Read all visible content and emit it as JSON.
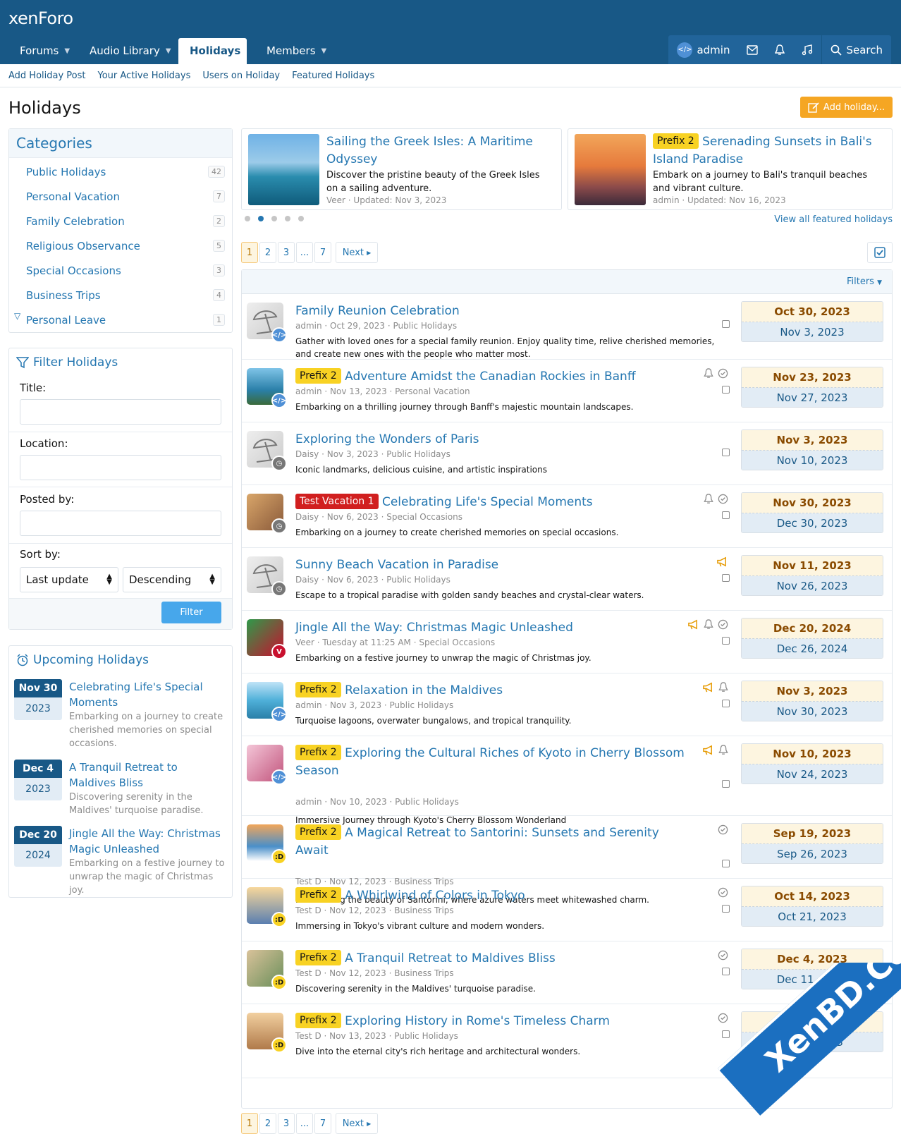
{
  "header": {
    "logo": "xenForo",
    "tabs": [
      {
        "label": "Forums"
      },
      {
        "label": "Audio Library"
      },
      {
        "label": "Holidays"
      },
      {
        "label": "Members"
      }
    ],
    "user": "admin",
    "search": "Search"
  },
  "subnav": [
    "Add Holiday Post",
    "Your Active Holidays",
    "Users on Holiday",
    "Featured Holidays"
  ],
  "page": {
    "title": "Holidays",
    "add_button": "Add holiday..."
  },
  "categories": {
    "title": "Categories",
    "items": [
      {
        "label": "Public Holidays",
        "count": "42"
      },
      {
        "label": "Personal Vacation",
        "count": "7"
      },
      {
        "label": "Family Celebration",
        "count": "2"
      },
      {
        "label": "Religious Observance",
        "count": "5"
      },
      {
        "label": "Special Occasions",
        "count": "3"
      },
      {
        "label": "Business Trips",
        "count": "4"
      },
      {
        "label": "Personal Leave",
        "count": "1"
      }
    ]
  },
  "filter": {
    "title": "Filter Holidays",
    "title_label": "Title:",
    "location_label": "Location:",
    "posted_label": "Posted by:",
    "sort_label": "Sort by:",
    "sort_value": "Last update",
    "order_value": "Descending",
    "button": "Filter"
  },
  "upcoming": {
    "title": "Upcoming Holidays",
    "items": [
      {
        "day": "Nov 30",
        "year": "2023",
        "title": "Celebrating Life's Special Moments",
        "desc": "Embarking on a journey to create cherished memories on special occasions."
      },
      {
        "day": "Dec 4",
        "year": "2023",
        "title": "A Tranquil Retreat to Maldives Bliss",
        "desc": "Discovering serenity in the Maldives' turquoise paradise."
      },
      {
        "day": "Dec 20",
        "year": "2024",
        "title": "Jingle All the Way: Christmas Magic Unleashed",
        "desc": "Embarking on a festive journey to unwrap the magic of Christmas joy."
      }
    ]
  },
  "featured": [
    {
      "prefix": "",
      "title": "Sailing the Greek Isles: A Maritime Odyssey",
      "desc": "Discover the pristine beauty of the Greek Isles on a sailing adventure.",
      "meta": "Veer · Updated: Nov 3, 2023"
    },
    {
      "prefix": "Prefix 2",
      "title": "Serenading Sunsets in Bali's Island Paradise",
      "desc": "Embark on a journey to Bali's tranquil beaches and vibrant culture.",
      "meta": "admin · Updated: Nov 16, 2023"
    }
  ],
  "view_all": "View all featured holidays",
  "pager": {
    "pages": [
      "1",
      "2",
      "3",
      "...",
      "7"
    ],
    "next": "Next"
  },
  "filters_link": "Filters",
  "rows": [
    {
      "prefix": "",
      "ptype": "",
      "title": "Family Reunion Celebration",
      "meta": "admin · Oct 29, 2023 · Public Holidays",
      "desc": "Gather with loved ones for a special family reunion. Enjoy quality time, relive cherished memories, and create new ones with the people who matter most.",
      "start": "Oct 30, 2023",
      "end": "Nov 3, 2023"
    },
    {
      "prefix": "Prefix 2",
      "ptype": "y",
      "title": "Adventure Amidst the Canadian Rockies in Banff",
      "meta": "admin · Nov 13, 2023 · Personal Vacation",
      "desc": "Embarking on a thrilling journey through Banff's majestic mountain landscapes.",
      "start": "Nov 23, 2023",
      "end": "Nov 27, 2023"
    },
    {
      "prefix": "",
      "ptype": "",
      "title": "Exploring the Wonders of Paris",
      "meta": "Daisy · Nov 3, 2023 · Public Holidays",
      "desc": "Iconic landmarks, delicious cuisine, and artistic inspirations",
      "start": "Nov 3, 2023",
      "end": "Nov 10, 2023"
    },
    {
      "prefix": "Test Vacation 1",
      "ptype": "r",
      "title": "Celebrating Life's Special Moments",
      "meta": "Daisy · Nov 6, 2023 · Special Occasions",
      "desc": "Embarking on a journey to create cherished memories on special occasions.",
      "start": "Nov 30, 2023",
      "end": "Dec 30, 2023"
    },
    {
      "prefix": "",
      "ptype": "",
      "title": "Sunny Beach Vacation in Paradise",
      "meta": "Daisy · Nov 6, 2023 · Public Holidays",
      "desc": "Escape to a tropical paradise with golden sandy beaches and crystal-clear waters.",
      "start": "Nov 11, 2023",
      "end": "Nov 26, 2023"
    },
    {
      "prefix": "",
      "ptype": "",
      "title": "Jingle All the Way: Christmas Magic Unleashed",
      "meta": "Veer · Tuesday at 11:25 AM · Special Occasions",
      "desc": "Embarking on a festive journey to unwrap the magic of Christmas joy.",
      "start": "Dec 20, 2024",
      "end": "Dec 26, 2024"
    },
    {
      "prefix": "Prefix 2",
      "ptype": "y",
      "title": "Relaxation in the Maldives",
      "meta": "admin · Nov 3, 2023 · Public Holidays",
      "desc": "Turquoise lagoons, overwater bungalows, and tropical tranquility.",
      "start": "Nov 3, 2023",
      "end": "Nov 30, 2023"
    },
    {
      "prefix": "Prefix 2",
      "ptype": "y",
      "title": "Exploring the Cultural Riches of Kyoto in Cherry Blossom Season",
      "meta": "admin · Nov 10, 2023 · Public Holidays",
      "desc": "Immersive Journey through Kyoto's Cherry Blossom Wonderland",
      "start": "Nov 10, 2023",
      "end": "Nov 24, 2023"
    },
    {
      "prefix": "Prefix 2",
      "ptype": "y",
      "title": "A Magical Retreat to Santorini: Sunsets and Serenity Await",
      "meta": "Test D · Nov 12, 2023 · Business Trips",
      "desc": "Discovering the beauty of Santorini, where azure waters meet whitewashed charm.",
      "start": "Sep 19, 2023",
      "end": "Sep 26, 2023"
    },
    {
      "prefix": "Prefix 2",
      "ptype": "y",
      "title": "A Whirlwind of Colors in Tokyo",
      "meta": "Test D · Nov 12, 2023 · Business Trips",
      "desc": "Immersing in Tokyo's vibrant culture and modern wonders.",
      "start": "Oct 14, 2023",
      "end": "Oct 21, 2023"
    },
    {
      "prefix": "Prefix 2",
      "ptype": "y",
      "title": "A Tranquil Retreat to Maldives Bliss",
      "meta": "Test D · Nov 12, 2023 · Business Trips",
      "desc": "Discovering serenity in the Maldives' turquoise paradise.",
      "start": "Dec 4, 2023",
      "end": "Dec 11, 2023"
    },
    {
      "prefix": "Prefix 2",
      "ptype": "y",
      "title": "Exploring History in Rome's Timeless Charm",
      "meta": "Test D · Nov 13, 2023 · Public Holidays",
      "desc": "Dive into the eternal city's rich heritage and architectural wonders.",
      "start": "Oct 1, 2023",
      "end": "Oct 8, 2023"
    }
  ],
  "watermark": "XenBD.Com"
}
